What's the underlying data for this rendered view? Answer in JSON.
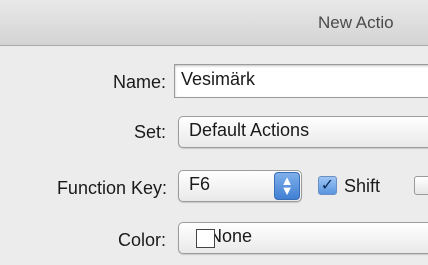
{
  "window": {
    "title": "New Actio"
  },
  "form": {
    "name_label": "Name:",
    "name_value": "Vesimärk",
    "set_label": "Set:",
    "set_value": "Default Actions",
    "function_key_label": "Function Key:",
    "function_key_value": "F6",
    "shift_label": "Shift",
    "shift_checked": true,
    "color_label": "Color:",
    "color_value": "None"
  },
  "icons": {
    "stepper": "up-down-arrows-icon",
    "checkmark": "checkmark-icon",
    "swatch": "color-swatch-icon"
  },
  "colors": {
    "accent": "#4a86d8",
    "window_bg": "#ececec"
  }
}
